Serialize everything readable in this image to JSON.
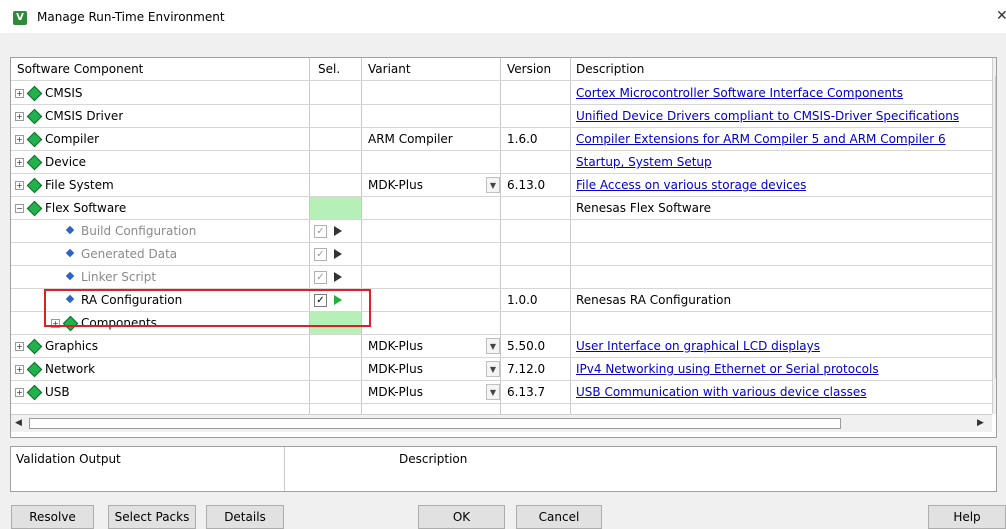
{
  "window": {
    "title": "Manage Run-Time Environment",
    "icon": "keil-app-icon"
  },
  "columns": {
    "component": "Software Component",
    "sel": "Sel.",
    "variant": "Variant",
    "version": "Version",
    "description": "Description"
  },
  "rows": [
    {
      "name": "CMSIS",
      "type": "group",
      "expander": "+",
      "variant": "",
      "version": "",
      "description": "Cortex Microcontroller Software Interface Components",
      "desc_link": true
    },
    {
      "name": "CMSIS Driver",
      "type": "group",
      "expander": "+",
      "variant": "",
      "version": "",
      "description": "Unified Device Drivers compliant to CMSIS-Driver Specifications",
      "desc_link": true
    },
    {
      "name": "Compiler",
      "type": "group",
      "expander": "+",
      "variant": "ARM Compiler",
      "version": "1.6.0",
      "description": "Compiler Extensions for ARM Compiler 5 and ARM Compiler 6",
      "desc_link": true
    },
    {
      "name": "Device",
      "type": "group",
      "expander": "+",
      "variant": "",
      "version": "",
      "description": "Startup, System Setup",
      "desc_link": true
    },
    {
      "name": "File System",
      "type": "group",
      "expander": "+",
      "variant": "MDK-Plus",
      "version": "6.13.0",
      "description": "File Access on various storage devices",
      "desc_link": true
    },
    {
      "name": "Flex Software",
      "type": "group",
      "expander": "-",
      "variant": "",
      "version": "",
      "description": "Renesas Flex Software",
      "desc_link": false
    },
    {
      "name": "Build Configuration",
      "type": "child",
      "grayed": true,
      "checked": true,
      "variant": "",
      "version": "",
      "description": ""
    },
    {
      "name": "Generated Data",
      "type": "child",
      "grayed": true,
      "checked": true,
      "variant": "",
      "version": "",
      "description": ""
    },
    {
      "name": "Linker Script",
      "type": "child",
      "grayed": true,
      "checked": true,
      "variant": "",
      "version": "",
      "description": ""
    },
    {
      "name": "RA Configuration",
      "type": "child",
      "grayed": false,
      "checked": true,
      "variant": "",
      "version": "1.0.0",
      "description": "Renesas RA Configuration",
      "desc_link": false
    },
    {
      "name": "Components",
      "type": "subgroup",
      "expander": "+",
      "variant": "",
      "version": "",
      "description": ""
    },
    {
      "name": "Graphics",
      "type": "group",
      "expander": "+",
      "variant": "MDK-Plus",
      "version": "5.50.0",
      "description": "User Interface on graphical LCD displays",
      "desc_link": true
    },
    {
      "name": "Network",
      "type": "group",
      "expander": "+",
      "variant": "MDK-Plus",
      "version": "7.12.0",
      "description": "IPv4 Networking using Ethernet or Serial protocols",
      "desc_link": true
    },
    {
      "name": "USB",
      "type": "group",
      "expander": "+",
      "variant": "MDK-Plus",
      "version": "6.13.7",
      "description": "USB Communication with various device classes",
      "desc_link": true
    }
  ],
  "validation": {
    "output_label": "Validation Output",
    "description_label": "Description"
  },
  "buttons": {
    "resolve": "Resolve",
    "select_packs": "Select Packs",
    "details": "Details",
    "ok": "OK",
    "cancel": "Cancel",
    "help": "Help"
  },
  "colors": {
    "link": "#0000cc",
    "selection_green": "#b6f0b6",
    "highlight_box": "#e02020"
  }
}
